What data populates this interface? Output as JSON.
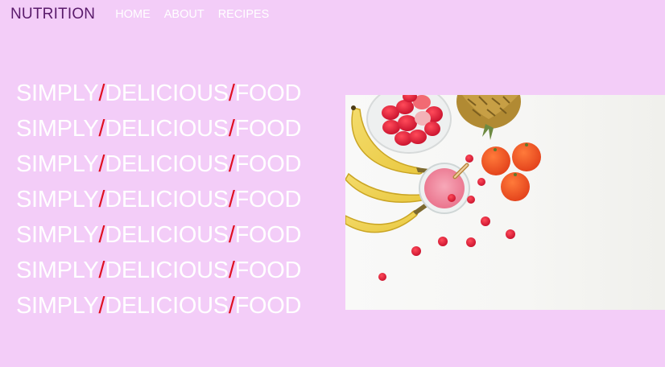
{
  "nav": {
    "brand": "NUTRITION",
    "links": [
      {
        "label": "HOME"
      },
      {
        "label": "ABOUT"
      },
      {
        "label": "RECIPES"
      }
    ]
  },
  "hero": {
    "lines": [
      {
        "w1": "SIMPLY",
        "s1": "/",
        "w2": "DELICIOUS",
        "s2": "/",
        "w3": "FOOD"
      },
      {
        "w1": "SIMPLY",
        "s1": "/",
        "w2": "DELICIOUS",
        "s2": "/",
        "w3": "FOOD"
      },
      {
        "w1": "SIMPLY",
        "s1": "/",
        "w2": "DELICIOUS",
        "s2": "/",
        "w3": "FOOD"
      },
      {
        "w1": "SIMPLY",
        "s1": "/",
        "w2": "DELICIOUS",
        "s2": "/",
        "w3": "FOOD"
      },
      {
        "w1": "SIMPLY",
        "s1": "/",
        "w2": "DELICIOUS",
        "s2": "/",
        "w3": "FOOD"
      },
      {
        "w1": "SIMPLY",
        "s1": "/",
        "w2": "DELICIOUS",
        "s2": "/",
        "w3": "FOOD"
      },
      {
        "w1": "SIMPLY",
        "s1": "/",
        "w2": "DELICIOUS",
        "s2": "/",
        "w3": "FOOD"
      }
    ]
  },
  "image": {
    "subject": "fruit-and-smoothie-photo"
  },
  "colors": {
    "page_background": "#f3cdf8",
    "brand_text": "#5a1b6b",
    "slash": "#e01020",
    "text": "#ffffff"
  }
}
